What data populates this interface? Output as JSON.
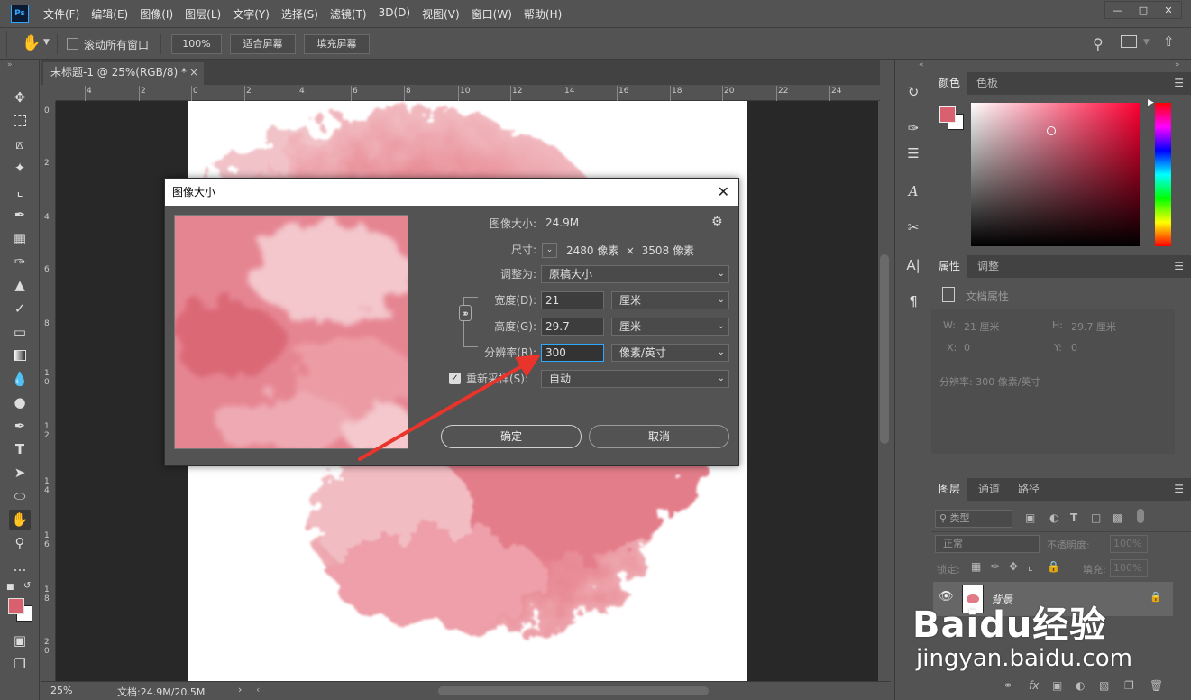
{
  "app": {
    "logo": "Ps"
  },
  "menu": [
    "文件(F)",
    "编辑(E)",
    "图像(I)",
    "图层(L)",
    "文字(Y)",
    "选择(S)",
    "滤镜(T)",
    "3D(D)",
    "视图(V)",
    "窗口(W)",
    "帮助(H)"
  ],
  "options": {
    "scroll_all_label": "滚动所有窗口",
    "zoom_value": "100%",
    "fit_screen_label": "适合屏幕",
    "fill_screen_label": "填充屏幕"
  },
  "document": {
    "tab_title": "未标题-1 @ 25%(RGB/8) *",
    "tab_close": "×"
  },
  "ruler": {
    "h_ticks": [
      "4",
      "2",
      "0",
      "2",
      "4",
      "6",
      "8",
      "10",
      "12",
      "14",
      "16",
      "18",
      "20",
      "22",
      "24"
    ],
    "v_ticks": [
      "0",
      "2",
      "4",
      "6",
      "8",
      "1 0",
      "1 2",
      "1 4",
      "1 6",
      "1 8",
      "2 0"
    ]
  },
  "status": {
    "zoom": "25%",
    "doc_info": "文档:24.9M/20.5M"
  },
  "dialog": {
    "title": "图像大小",
    "image_size_label": "图像大小:",
    "image_size_value": "24.9M",
    "dimensions_label": "尺寸:",
    "dimensions_value": "2480 像素  ×  3508 像素",
    "fit_to_label": "调整为:",
    "fit_to_value": "原稿大小",
    "width_label": "宽度(D):",
    "width_value": "21",
    "width_unit": "厘米",
    "height_label": "高度(G):",
    "height_value": "29.7",
    "height_unit": "厘米",
    "resolution_label": "分辨率(R):",
    "resolution_value": "300",
    "resolution_unit": "像素/英寸",
    "resample_label": "重新采样(S):",
    "resample_value": "自动",
    "ok_label": "确定",
    "cancel_label": "取消"
  },
  "color_panel": {
    "tabs": [
      "颜色",
      "色板"
    ],
    "fg_color": "#d9606e"
  },
  "properties_panel": {
    "tabs": [
      "属性",
      "调整"
    ],
    "doc_props_label": "文档属性",
    "w_label": "W:",
    "w_value": "21 厘米",
    "h_label": "H:",
    "h_value": "29.7 厘米",
    "x_label": "X:",
    "x_value": "0",
    "y_label": "Y:",
    "y_value": "0",
    "resolution_text": "分辨率: 300 像素/英寸"
  },
  "layers_panel": {
    "tabs": [
      "图层",
      "通道",
      "路径"
    ],
    "filter_label": "类型",
    "blend_mode": "正常",
    "opacity_label": "不透明度:",
    "opacity_value": "100%",
    "lock_label": "锁定:",
    "fill_label": "填充:",
    "fill_value": "100%",
    "layer_name": "背景"
  },
  "watermark": {
    "line1": "Baidu经验",
    "line2": "jingyan.baidu.com"
  },
  "colors": {
    "accent": "#31a8ff",
    "pink": "#e07a86",
    "arrow": "#e8342a"
  }
}
